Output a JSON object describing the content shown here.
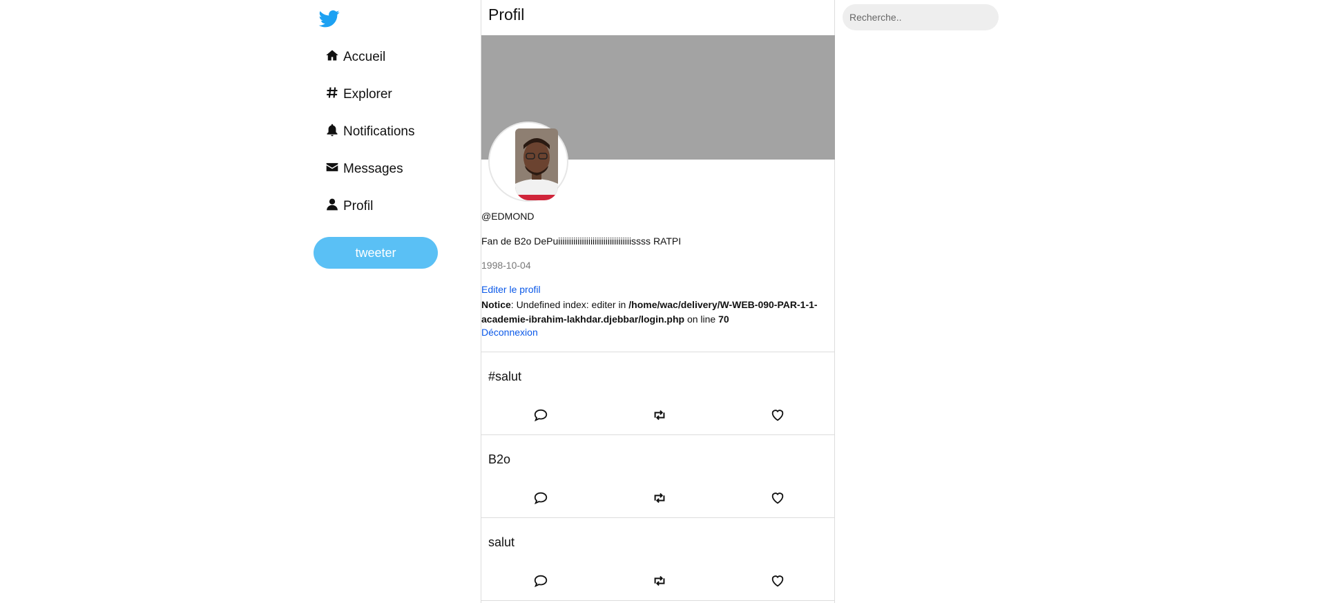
{
  "sidebar": {
    "items": [
      {
        "label": "Accueil",
        "icon": "home-icon"
      },
      {
        "label": "Explorer",
        "icon": "hashtag-icon"
      },
      {
        "label": "Notifications",
        "icon": "bell-icon"
      },
      {
        "label": "Messages",
        "icon": "envelope-icon"
      },
      {
        "label": "Profil",
        "icon": "user-icon"
      }
    ],
    "tweet_button": "tweeter"
  },
  "main": {
    "title": "Profil",
    "handle": "@EDMOND",
    "bio": "Fan de B2o DePuiiiiiiiiiiiiiiiiiiiiiiiiiiiiiiiiiissss RATPI",
    "birthdate": "1998-10-04",
    "edit_link": "Editer le profil",
    "notice": {
      "label": "Notice",
      "message": ": Undefined index: editer in ",
      "path": "/home/wac/delivery/W-WEB-090-PAR-1-1-academie-ibrahim-lakhdar.djebbar/login.php",
      "on_line": " on line ",
      "line": "70"
    },
    "logout_link": "Déconnexion"
  },
  "tweets": [
    {
      "text": "#salut"
    },
    {
      "text": "B2o"
    },
    {
      "text": "salut"
    }
  ],
  "search": {
    "placeholder": "Recherche.."
  },
  "colors": {
    "brand": "#1da1f2",
    "tweet_button": "#5ac0f5",
    "banner": "#a3a3a3",
    "link": "#0a58e8"
  }
}
